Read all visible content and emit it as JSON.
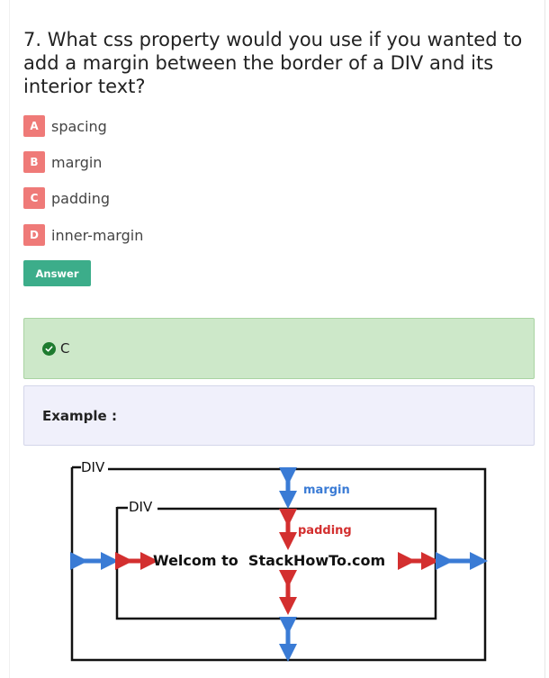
{
  "question": {
    "text": "7. What css property would you use if you wanted to add a margin between the border of a DIV and its interior text?"
  },
  "options": [
    {
      "letter": "A",
      "text": "spacing"
    },
    {
      "letter": "B",
      "text": "margin"
    },
    {
      "letter": "C",
      "text": "padding"
    },
    {
      "letter": "D",
      "text": "inner-margin"
    }
  ],
  "answer_button": {
    "label": "Answer"
  },
  "answer": {
    "icon": "check-circle-icon",
    "text": "C",
    "color": "#cde8c9"
  },
  "example": {
    "label": "Example :"
  },
  "diagram": {
    "outer_label": "DIV",
    "inner_label": "DIV",
    "margin_label": "margin",
    "padding_label": "padding",
    "welcome_text": "Welcom to  StackHowTo.com",
    "margin_color": "#3a7bd5",
    "padding_color": "#d32f2f"
  },
  "colors": {
    "option_badge": "#ef7a78",
    "answer_button": "#3cad8a",
    "example_box": "#f0f0fb"
  }
}
